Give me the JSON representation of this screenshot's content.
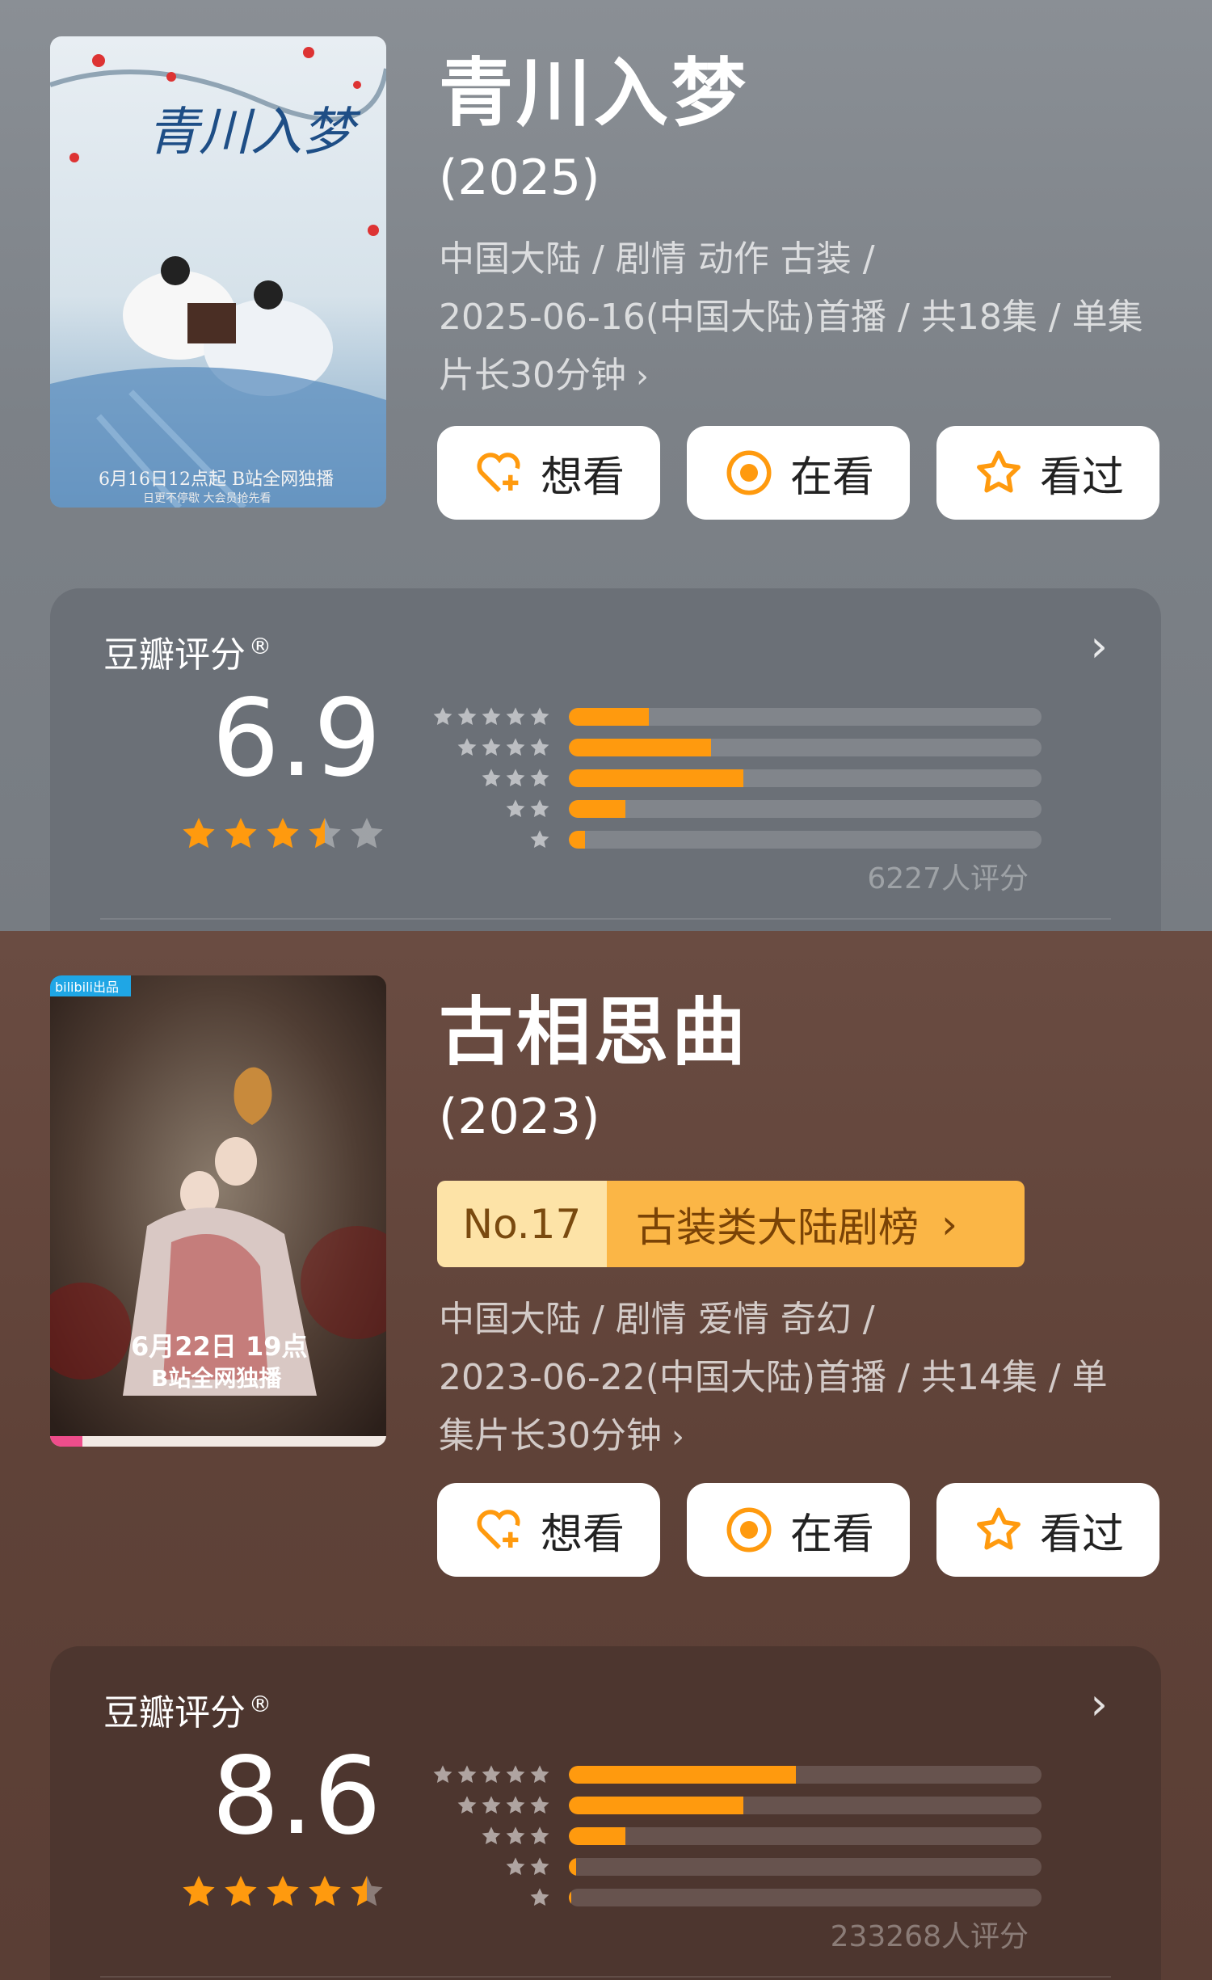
{
  "colors": {
    "accent": "#ff9a0e",
    "star": "#ff9a0e",
    "rank_bg": "#fbb646"
  },
  "buttons": {
    "want": "想看",
    "watching": "在看",
    "watched": "看过"
  },
  "shows": [
    {
      "title": "青川入梦",
      "year": "(2025)",
      "meta_lines": [
        "中国大陆 / 剧情 动作 古装 /",
        "2025-06-16(中国大陆)首播 / 共18集 / 单集",
        "片长30分钟"
      ],
      "poster_text": {
        "title": "青川入梦",
        "bottom": "6月16日12点起 B站全网独播",
        "bottom2": "日更不停歇 大会员抢先看"
      },
      "rating": {
        "label": "豆瓣评分",
        "reg": "®",
        "score": "6.9",
        "stars": 3.5,
        "count": "6227人评分",
        "distribution": [
          0.17,
          0.3,
          0.37,
          0.12,
          0.035
        ]
      }
    },
    {
      "title": "古相思曲",
      "year": "(2023)",
      "rank": {
        "number": "No.17",
        "list": "古装类大陆剧榜"
      },
      "meta_lines": [
        "中国大陆 / 剧情 爱情 奇幻 /",
        "2023-06-22(中国大陆)首播 / 共14集 / 单",
        "集片长30分钟"
      ],
      "poster_text": {
        "badge": "bilibili出品",
        "date": "6月22日 19点",
        "sub": "B站全网独播"
      },
      "rating": {
        "label": "豆瓣评分",
        "reg": "®",
        "score": "8.6",
        "stars": 4.5,
        "count": "233268人评分",
        "distribution": [
          0.48,
          0.37,
          0.12,
          0.015,
          0.005
        ]
      }
    }
  ]
}
